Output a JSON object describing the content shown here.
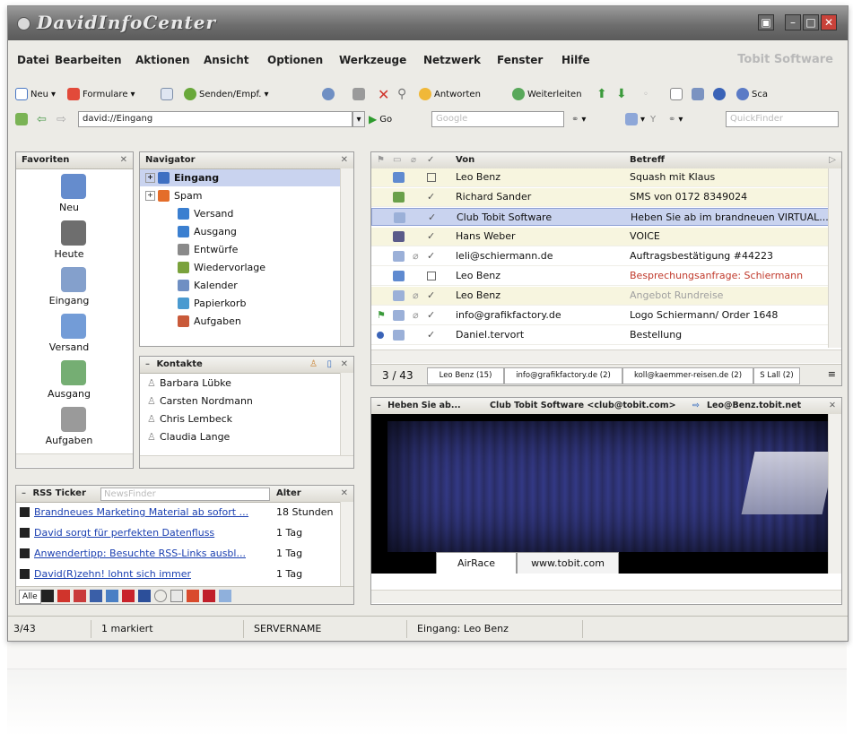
{
  "window": {
    "title": "DavidInfoCenter"
  },
  "menu": {
    "items": [
      "Datei",
      "Bearbeiten",
      "Aktionen",
      "Ansicht",
      "Optionen",
      "Werkzeuge",
      "Netzwerk",
      "Fenster",
      "Hilfe"
    ],
    "brand": "Tobit Software"
  },
  "toolbar1": {
    "neu": "Neu",
    "formulare": "Formulare",
    "senden": "Senden/Empf.",
    "antworten": "Antworten",
    "weiterleiten": "Weiterleiten",
    "sca": "Sca"
  },
  "toolbar2": {
    "address": "david://Eingang",
    "go": "Go",
    "search_placeholder": "Google",
    "quickfinder": "QuickFinder"
  },
  "favorites": {
    "title": "Favoriten",
    "items": [
      "Neu",
      "Heute",
      "Eingang",
      "Versand",
      "Ausgang",
      "Aufgaben"
    ]
  },
  "navigator": {
    "title": "Navigator",
    "items": [
      "Eingang",
      "Spam",
      "Versand",
      "Ausgang",
      "Entwürfe",
      "Wiedervorlage",
      "Kalender",
      "Papierkorb",
      "Aufgaben"
    ]
  },
  "contacts": {
    "title": "Kontakte",
    "items": [
      "Barbara Lübke",
      "Carsten Nordmann",
      "Chris Lembeck",
      "Claudia Lange"
    ]
  },
  "rss": {
    "title": "RSS Ticker",
    "finder_placeholder": "NewsFinder",
    "age_header": "Alter",
    "items": [
      {
        "title": "Brandneues Marketing Material ab sofort ...",
        "age": "18 Stunden"
      },
      {
        "title": "David sorgt für perfekten Datenfluss",
        "age": "1 Tag"
      },
      {
        "title": "Anwendertipp: Besuchte RSS-Links ausbl...",
        "age": "1 Tag"
      },
      {
        "title": "David(R)zehn! lohnt sich immer",
        "age": "1 Tag"
      }
    ],
    "filter_all": "Alle"
  },
  "maillist": {
    "col_from": "Von",
    "col_subject": "Betreff",
    "rows": [
      {
        "from": "Leo Benz",
        "subject": "Squash mit Klaus",
        "subject_color": "#111111"
      },
      {
        "from": "Richard Sander",
        "subject": "SMS von 0172 8349024",
        "subject_color": "#111111"
      },
      {
        "from": "Club Tobit Software",
        "subject": "Heben Sie ab im brandneuen VIRTUAL...",
        "subject_color": "#111111"
      },
      {
        "from": "Hans Weber",
        "subject": "VOICE",
        "subject_color": "#111111"
      },
      {
        "from": "leli@schiermann.de",
        "subject": "Auftragsbestätigung #44223",
        "subject_color": "#111111"
      },
      {
        "from": "Leo Benz",
        "subject": "Besprechungsanfrage: Schiermann",
        "subject_color": "#c0392b"
      },
      {
        "from": "Leo Benz",
        "subject": "Angebot Rundreise",
        "subject_color": "#a0a0a0"
      },
      {
        "from": "info@grafikfactory.de",
        "subject": "Logo Schiermann/ Order 1648",
        "subject_color": "#111111"
      },
      {
        "from": "Daniel.tervort",
        "subject": "Bestellung",
        "subject_color": "#111111"
      }
    ],
    "count": "3 / 43",
    "tabs": [
      "Leo Benz (15)",
      "info@grafikfactory.de (2)",
      "koll@kaemmer-reisen.de (2)",
      "S Lall (2)"
    ]
  },
  "preview": {
    "subject": "Heben Sie ab...",
    "from": "Club Tobit Software <club@tobit.com>",
    "to": "Leo@Benz.tobit.net",
    "tabs": [
      "AirRace",
      "www.tobit.com"
    ]
  },
  "status": {
    "count": "3/43",
    "marked": "1 markiert",
    "server": "SERVERNAME",
    "folder": "Eingang: Leo Benz"
  },
  "colors": {
    "selection": "#c9d3ef",
    "highlight_rows": "#f7f5df",
    "link": "#1a3fb0",
    "titlebar": "#7a7a7a"
  }
}
